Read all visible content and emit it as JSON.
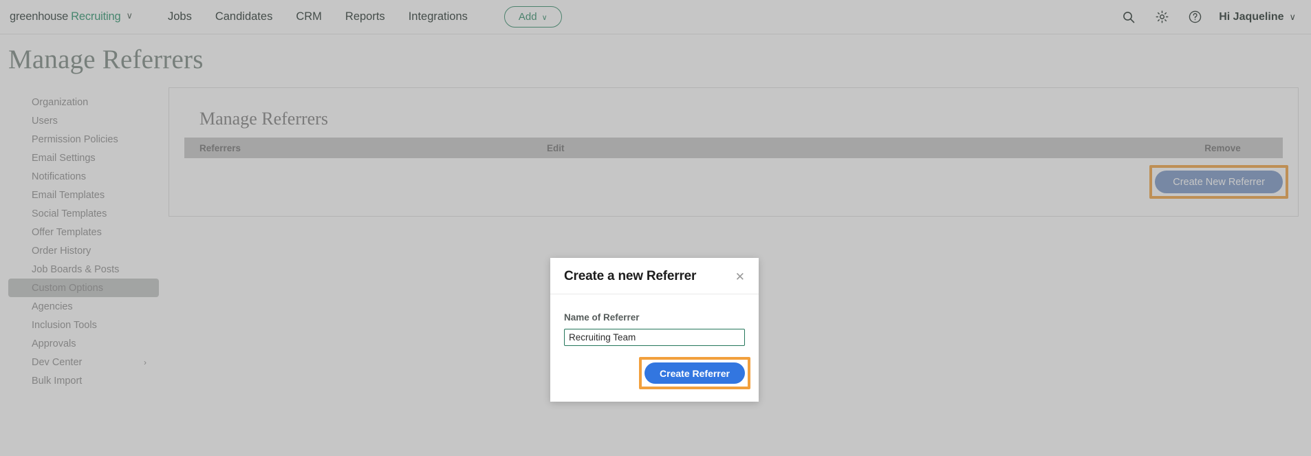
{
  "topnav": {
    "brand_primary": "greenhouse",
    "brand_secondary": "Recruiting",
    "brand_caret": "∨",
    "links": [
      {
        "label": "Jobs"
      },
      {
        "label": "Candidates"
      },
      {
        "label": "CRM"
      },
      {
        "label": "Reports"
      },
      {
        "label": "Integrations"
      }
    ],
    "add_button": {
      "label": "Add",
      "caret": "∨"
    },
    "icons": {
      "search": "search-icon",
      "gear": "gear-icon",
      "help": "help-icon"
    },
    "greeting": {
      "label": "Hi Jaqueline",
      "caret": "∨"
    }
  },
  "page": {
    "title": "Manage Referrers"
  },
  "sidebar": {
    "items": [
      {
        "label": "Organization",
        "active": false,
        "chevron": ""
      },
      {
        "label": "Users",
        "active": false,
        "chevron": ""
      },
      {
        "label": "Permission Policies",
        "active": false,
        "chevron": ""
      },
      {
        "label": "Email Settings",
        "active": false,
        "chevron": ""
      },
      {
        "label": "Notifications",
        "active": false,
        "chevron": ""
      },
      {
        "label": "Email Templates",
        "active": false,
        "chevron": ""
      },
      {
        "label": "Social Templates",
        "active": false,
        "chevron": ""
      },
      {
        "label": "Offer Templates",
        "active": false,
        "chevron": ""
      },
      {
        "label": "Order History",
        "active": false,
        "chevron": ""
      },
      {
        "label": "Job Boards & Posts",
        "active": false,
        "chevron": ""
      },
      {
        "label": "Custom Options",
        "active": true,
        "chevron": ""
      },
      {
        "label": "Agencies",
        "active": false,
        "chevron": ""
      },
      {
        "label": "Inclusion Tools",
        "active": false,
        "chevron": ""
      },
      {
        "label": "Approvals",
        "active": false,
        "chevron": ""
      },
      {
        "label": "Dev Center",
        "active": false,
        "chevron": "›"
      },
      {
        "label": "Bulk Import",
        "active": false,
        "chevron": ""
      }
    ]
  },
  "card": {
    "title": "Manage Referrers",
    "table": {
      "columns": [
        "Referrers",
        "Edit",
        "Remove"
      ],
      "rows": []
    },
    "create_new_button": {
      "label": "Create New Referrer",
      "highlighted": true
    }
  },
  "modal": {
    "title": "Create a new Referrer",
    "close_icon": "✕",
    "field": {
      "label": "Name of Referrer",
      "value": "Recruiting Team",
      "placeholder": ""
    },
    "submit_button": {
      "label": "Create Referrer",
      "highlighted": true
    }
  },
  "colors": {
    "brand_green": "#27926a",
    "accent_blue": "#3276e0",
    "muted_blue": "#7795c4",
    "highlight_orange": "#f2a03d",
    "title_gray": "#77857f",
    "input_border_green": "#24765b"
  }
}
